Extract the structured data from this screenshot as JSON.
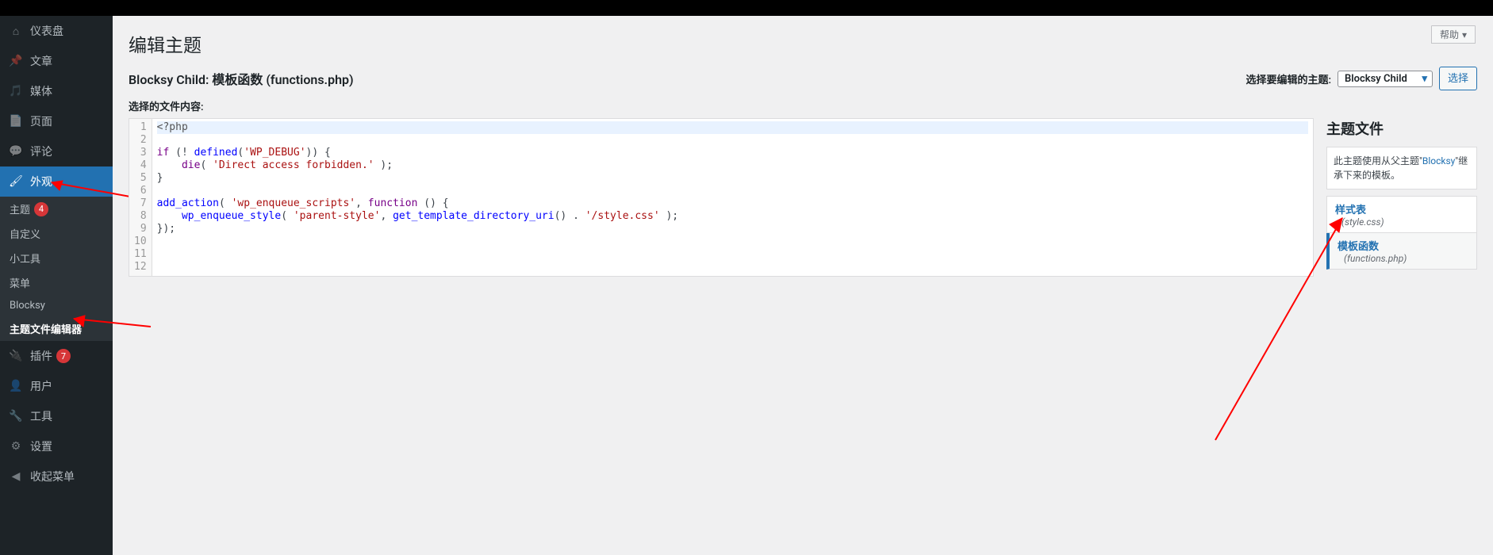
{
  "topbar": {},
  "sidebar": {
    "items": [
      {
        "icon": "dashboard-icon",
        "label": "仪表盘"
      },
      {
        "icon": "pin-icon",
        "label": "文章"
      },
      {
        "icon": "media-icon",
        "label": "媒体"
      },
      {
        "icon": "page-icon",
        "label": "页面"
      },
      {
        "icon": "comment-icon",
        "label": "评论"
      },
      {
        "icon": "brush-icon",
        "label": "外观"
      },
      {
        "icon": "plugin-icon",
        "label": "插件",
        "badge": "7"
      },
      {
        "icon": "user-icon",
        "label": "用户"
      },
      {
        "icon": "wrench-icon",
        "label": "工具"
      },
      {
        "icon": "settings-icon",
        "label": "设置"
      },
      {
        "icon": "collapse-icon",
        "label": "收起菜单"
      }
    ],
    "appearance_sub": [
      {
        "label": "主题",
        "badge": "4"
      },
      {
        "label": "自定义"
      },
      {
        "label": "小工具"
      },
      {
        "label": "菜单"
      },
      {
        "label": "Blocksy"
      },
      {
        "label": "主题文件编辑器",
        "current": true
      }
    ]
  },
  "header": {
    "help_label": "帮助",
    "page_title": "编辑主题",
    "file_title": "Blocksy Child: 模板函数 (functions.php)",
    "select_label": "选择要编辑的主题:",
    "selected_theme": "Blocksy Child",
    "select_btn": "选择",
    "chosen_label": "选择的文件内容:"
  },
  "code": {
    "lines": [
      {
        "n": 1,
        "seg": [
          {
            "t": "<?php",
            "c": "tok-meta"
          }
        ],
        "hl": true
      },
      {
        "n": 2,
        "seg": []
      },
      {
        "n": 3,
        "seg": [
          {
            "t": "if",
            "c": "tok-kw"
          },
          {
            "t": " (! "
          },
          {
            "t": "defined",
            "c": "tok-var"
          },
          {
            "t": "("
          },
          {
            "t": "'WP_DEBUG'",
            "c": "tok-str"
          },
          {
            "t": ")) {"
          }
        ]
      },
      {
        "n": 4,
        "seg": [
          {
            "t": "    "
          },
          {
            "t": "die",
            "c": "tok-kw"
          },
          {
            "t": "( "
          },
          {
            "t": "'Direct access forbidden.'",
            "c": "tok-str"
          },
          {
            "t": " );"
          }
        ]
      },
      {
        "n": 5,
        "seg": [
          {
            "t": "}"
          }
        ]
      },
      {
        "n": 6,
        "seg": []
      },
      {
        "n": 7,
        "seg": [
          {
            "t": "add_action",
            "c": "tok-var"
          },
          {
            "t": "( "
          },
          {
            "t": "'wp_enqueue_scripts'",
            "c": "tok-str"
          },
          {
            "t": ", "
          },
          {
            "t": "function",
            "c": "tok-kw"
          },
          {
            "t": " () {"
          }
        ]
      },
      {
        "n": 8,
        "seg": [
          {
            "t": "    "
          },
          {
            "t": "wp_enqueue_style",
            "c": "tok-var"
          },
          {
            "t": "( "
          },
          {
            "t": "'parent-style'",
            "c": "tok-str"
          },
          {
            "t": ", "
          },
          {
            "t": "get_template_directory_uri",
            "c": "tok-var"
          },
          {
            "t": "() . "
          },
          {
            "t": "'/style.css'",
            "c": "tok-str"
          },
          {
            "t": " );"
          }
        ]
      },
      {
        "n": 9,
        "seg": [
          {
            "t": "});"
          }
        ]
      },
      {
        "n": 10,
        "seg": []
      },
      {
        "n": 11,
        "seg": []
      },
      {
        "n": 12,
        "seg": []
      }
    ]
  },
  "files_panel": {
    "heading": "主题文件",
    "inherit_pre": "此主题使用从父主题\"",
    "inherit_link": "Blocksy",
    "inherit_post": "\"继承下来的模板。",
    "files": [
      {
        "title": "样式表",
        "name": "(style.css)"
      },
      {
        "title": "模板函数",
        "name": "(functions.php)",
        "active": true
      }
    ]
  }
}
